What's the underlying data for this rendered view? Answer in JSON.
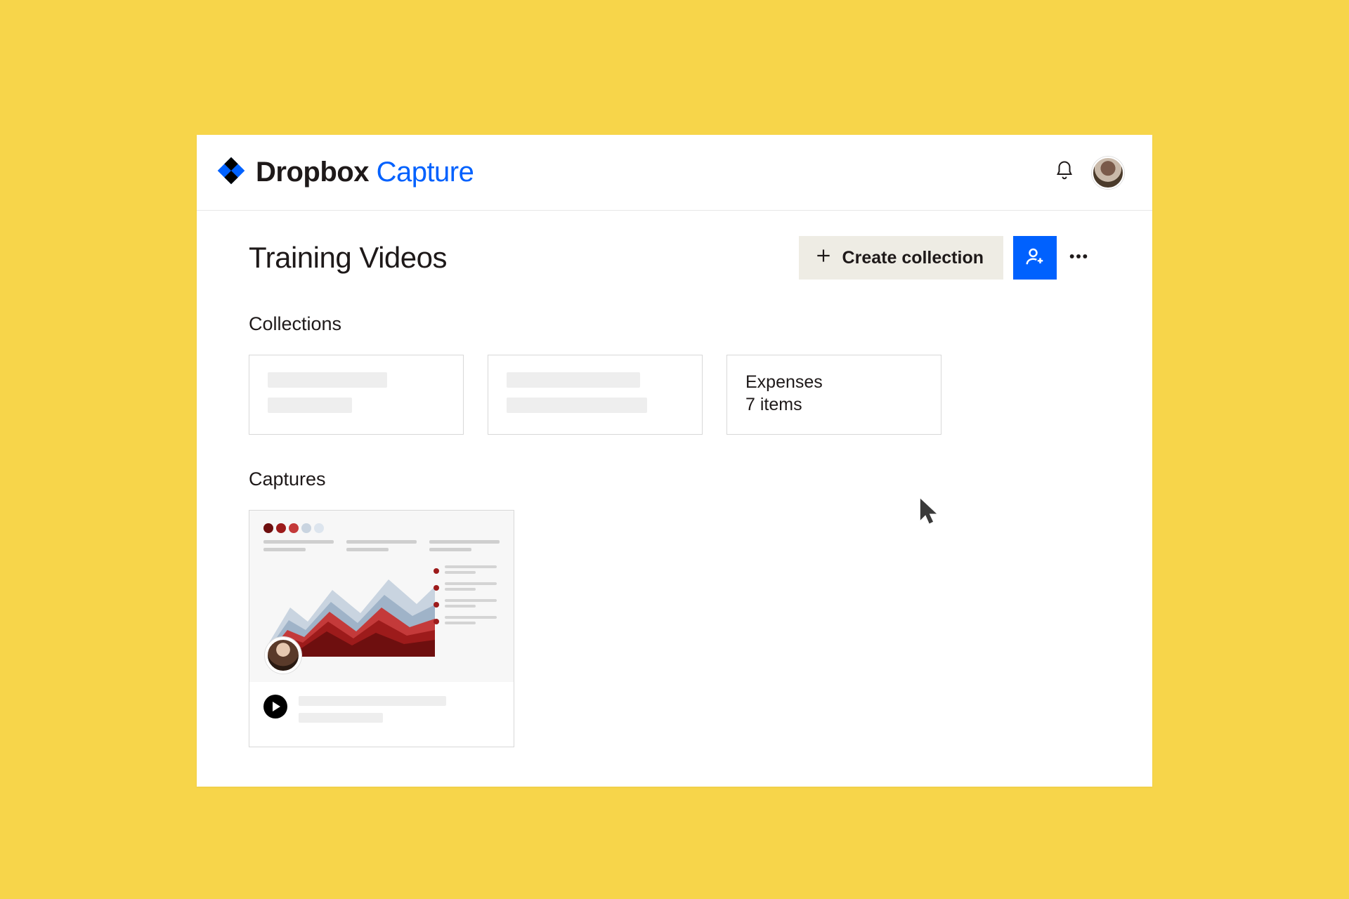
{
  "brand": {
    "name": "Dropbox",
    "product": "Capture"
  },
  "header": {
    "bell_icon": "bell-icon",
    "avatar": "user-avatar"
  },
  "page": {
    "title": "Training Videos",
    "create_label": "Create collection"
  },
  "sections": {
    "collections_label": "Collections",
    "captures_label": "Captures"
  },
  "collections": [
    {
      "title": "",
      "subtitle": "",
      "placeholder": true
    },
    {
      "title": "",
      "subtitle": "",
      "placeholder": true
    },
    {
      "title": "Expenses",
      "subtitle": "7 items",
      "placeholder": false
    }
  ],
  "captures": [
    {
      "title": "",
      "subtitle": "",
      "has_video": true,
      "placeholder": true
    }
  ],
  "colors": {
    "accent": "#0061fe",
    "page_bg": "#f7d54a",
    "button_bg": "#eeece4"
  }
}
